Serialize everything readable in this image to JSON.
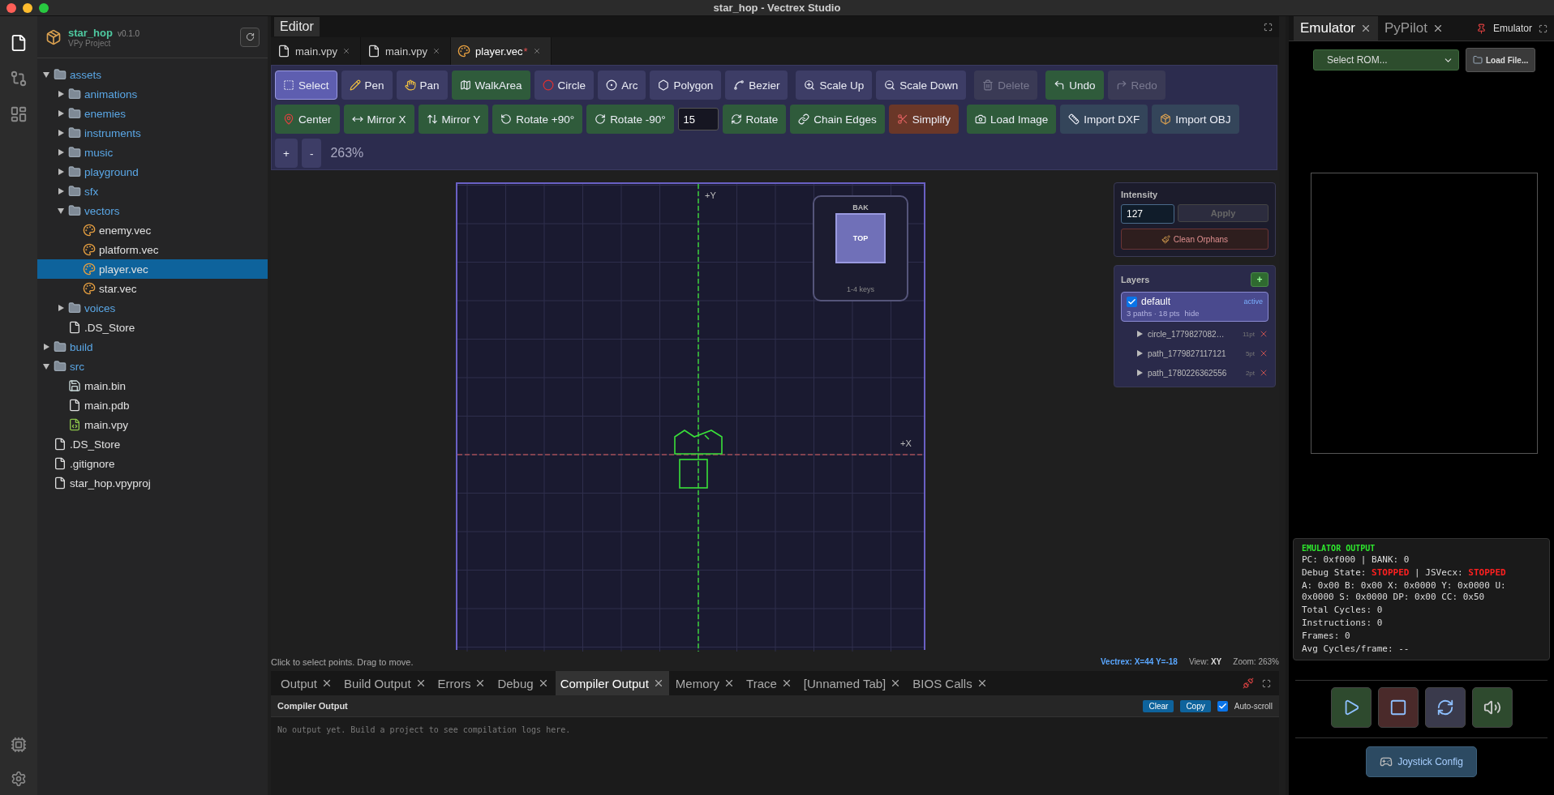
{
  "window": {
    "title": "star_hop - Vectrex Studio"
  },
  "activity_bar": {
    "items": [
      {
        "selected": true
      },
      {
        "selected": false
      },
      {
        "selected": false
      }
    ]
  },
  "project": {
    "name": "star_hop",
    "version": "v0.1.0",
    "subtitle": "VPy Project"
  },
  "file_tree": [
    {
      "label": "assets",
      "kind": "folder",
      "expanded": true,
      "selected": false,
      "children": [
        {
          "label": "animations",
          "kind": "folder",
          "expanded": false,
          "selected": false
        },
        {
          "label": "enemies",
          "kind": "folder",
          "expanded": false,
          "selected": false
        },
        {
          "label": "instruments",
          "kind": "folder",
          "expanded": false,
          "selected": false
        },
        {
          "label": "music",
          "kind": "folder",
          "expanded": false,
          "selected": false
        },
        {
          "label": "playground",
          "kind": "folder",
          "expanded": false,
          "selected": false
        },
        {
          "label": "sfx",
          "kind": "folder",
          "expanded": false,
          "selected": false
        },
        {
          "label": "vectors",
          "kind": "folder",
          "expanded": true,
          "selected": false,
          "children": [
            {
              "label": "enemy.vec",
              "kind": "vector",
              "selected": false
            },
            {
              "label": "platform.vec",
              "kind": "vector",
              "selected": false
            },
            {
              "label": "player.vec",
              "kind": "vector",
              "selected": true
            },
            {
              "label": "star.vec",
              "kind": "vector",
              "selected": false
            }
          ]
        },
        {
          "label": "voices",
          "kind": "folder",
          "expanded": false,
          "selected": false
        },
        {
          "label": ".DS_Store",
          "kind": "file",
          "selected": false
        }
      ]
    },
    {
      "label": "build",
      "kind": "folder",
      "expanded": false,
      "selected": false
    },
    {
      "label": "src",
      "kind": "folder",
      "expanded": true,
      "selected": false,
      "children": [
        {
          "label": "main.bin",
          "kind": "binary",
          "selected": false
        },
        {
          "label": "main.pdb",
          "kind": "file",
          "selected": false
        },
        {
          "label": "main.vpy",
          "kind": "python",
          "selected": false
        }
      ]
    },
    {
      "label": ".DS_Store",
      "kind": "file",
      "selected": false
    },
    {
      "label": ".gitignore",
      "kind": "file",
      "selected": false
    },
    {
      "label": "star_hop.vpyproj",
      "kind": "file",
      "selected": false
    }
  ],
  "editor": {
    "title": "Editor",
    "tabs": [
      {
        "label": "main.vpy",
        "kind": "file",
        "selected": false
      },
      {
        "label": "main.vpy",
        "kind": "file",
        "selected": false
      },
      {
        "label": "player.vec",
        "kind": "vector",
        "selected": true,
        "marker": "*"
      }
    ]
  },
  "toolbar": {
    "rows": [
      {
        "groups": [
          [
            {
              "kind": "button",
              "label": "Select",
              "color": "#5e5eb0",
              "selected": true,
              "disabled": false
            },
            {
              "kind": "button",
              "label": "Pen",
              "color": "#3d3d66",
              "selected": false,
              "disabled": false
            },
            {
              "kind": "button",
              "label": "Pan",
              "color": "#3d3d66",
              "selected": false,
              "disabled": false
            },
            {
              "kind": "button",
              "label": "WalkArea",
              "color": "#2f5b3b",
              "selected": false,
              "disabled": false
            },
            {
              "kind": "button",
              "label": "Circle",
              "color": "#3d3d66",
              "selected": false,
              "disabled": false
            },
            {
              "kind": "button",
              "label": "Arc",
              "color": "#3d3d66",
              "selected": false,
              "disabled": false
            },
            {
              "kind": "button",
              "label": "Polygon",
              "color": "#3d3d66",
              "selected": false,
              "disabled": false
            },
            {
              "kind": "button",
              "label": "Bezier",
              "color": "#3d3d66",
              "selected": false,
              "disabled": false
            }
          ],
          [
            {
              "kind": "button",
              "label": "Scale Up",
              "color": "#3d3d66",
              "selected": false,
              "disabled": false
            },
            {
              "kind": "button",
              "label": "Scale Down",
              "color": "#3d3d66",
              "selected": false,
              "disabled": false
            }
          ],
          [
            {
              "kind": "button",
              "label": "Delete",
              "color": "#3a3a55",
              "selected": false,
              "disabled": true
            }
          ],
          [
            {
              "kind": "button",
              "label": "Undo",
              "color": "#2f5b3b",
              "selected": false,
              "disabled": false
            },
            {
              "kind": "button",
              "label": "Redo",
              "color": "#3a3a55",
              "selected": false,
              "disabled": true
            }
          ]
        ]
      },
      {
        "groups": [
          [
            {
              "kind": "button",
              "label": "Center",
              "color": "#2f5b3b",
              "selected": false,
              "disabled": false
            },
            {
              "kind": "button",
              "label": "Mirror X",
              "color": "#2f5b3b",
              "selected": false,
              "disabled": false
            },
            {
              "kind": "button",
              "label": "Mirror Y",
              "color": "#2f5b3b",
              "selected": false,
              "disabled": false
            },
            {
              "kind": "button",
              "label": "Rotate +90°",
              "color": "#2f5b3b",
              "selected": false,
              "disabled": false
            },
            {
              "kind": "button",
              "label": "Rotate -90°",
              "color": "#2f5b3b",
              "selected": false,
              "disabled": false
            },
            {
              "kind": "field",
              "value": "15"
            },
            {
              "kind": "button",
              "label": "Rotate",
              "color": "#2f5b3b",
              "selected": false,
              "disabled": false
            },
            {
              "kind": "button",
              "label": "Chain Edges",
              "color": "#2f5b3b",
              "selected": false,
              "disabled": false
            },
            {
              "kind": "button",
              "label": "Simplify",
              "color": "#6a3728",
              "selected": false,
              "disabled": false
            }
          ],
          [
            {
              "kind": "button",
              "label": "Load Image",
              "color": "#2f5b3b",
              "selected": false,
              "disabled": false
            },
            {
              "kind": "button",
              "label": "Import DXF",
              "color": "#34455a",
              "selected": false,
              "disabled": false
            },
            {
              "kind": "button",
              "label": "Import OBJ",
              "color": "#34455a",
              "selected": false,
              "disabled": false
            }
          ]
        ]
      },
      {
        "groups": [
          [
            {
              "kind": "button",
              "label": "+",
              "color": "#3d3d66",
              "selected": false,
              "disabled": false
            },
            {
              "kind": "button",
              "label": "-",
              "color": "#3d3d66",
              "selected": false,
              "disabled": false
            },
            {
              "kind": "readout",
              "value": "263%"
            }
          ]
        ]
      }
    ]
  },
  "canvas": {
    "y_label": "+Y",
    "x_label": "+X",
    "view_cube": {
      "back": "BAK",
      "face": "TOP",
      "hint": "1-4 keys"
    }
  },
  "intensity": {
    "title": "Intensity",
    "value": "127",
    "apply": "Apply",
    "apply_disabled": true,
    "clean": "Clean Orphans"
  },
  "layers": {
    "title": "Layers",
    "add": "+",
    "items": [
      {
        "name": "default",
        "checked": true,
        "selected": true,
        "badge": "active",
        "meta": "3 paths · 18 pts",
        "toggle": "hide",
        "paths": [
          {
            "name": "circle_1779827082…",
            "points": "11pt"
          },
          {
            "name": "path_1779827117121",
            "points": "5pt"
          },
          {
            "name": "path_1780226362556",
            "points": "2pt"
          }
        ]
      }
    ]
  },
  "status": {
    "hint": "Click to select points. Drag to move.",
    "coords": "Vectrex: X=44 Y=-18",
    "view": "View: **XY**",
    "zoom": "Zoom: 263%"
  },
  "bottom_panel": {
    "tabs": [
      {
        "label": "Output",
        "selected": false
      },
      {
        "label": "Build Output",
        "selected": false
      },
      {
        "label": "Errors",
        "selected": false
      },
      {
        "label": "Debug",
        "selected": false
      },
      {
        "label": "Compiler Output",
        "selected": true
      },
      {
        "label": "Memory",
        "selected": false
      },
      {
        "label": "Trace",
        "selected": false
      },
      {
        "label": "[Unnamed Tab]",
        "selected": false
      },
      {
        "label": "BIOS Calls",
        "selected": false
      }
    ],
    "title": "Compiler Output",
    "buttons": [
      "Clear",
      "Copy"
    ],
    "auto_scroll": {
      "label": "Auto-scroll",
      "checked": true
    },
    "placeholder": "No output yet. Build a project to see compilation logs here."
  },
  "emulator": {
    "tabs": [
      {
        "label": "Emulator",
        "selected": true
      },
      {
        "label": "PyPilot",
        "selected": false
      }
    ],
    "pinned": "Emulator",
    "rom_select": "Select ROM...",
    "load": "Load File...",
    "output": {
      "title": "EMULATOR OUTPUT",
      "lines": [
        [
          {
            "text": "PC: 0xf000 | BANK: 0",
            "alert": false
          }
        ],
        [
          {
            "text": "Debug State: ",
            "alert": false
          },
          {
            "text": "STOPPED",
            "alert": true
          },
          {
            "text": " | JSVecx: ",
            "alert": false
          },
          {
            "text": "STOPPED",
            "alert": true
          }
        ],
        [
          {
            "text": "A: 0x00 B: 0x00 X: 0x0000 Y: 0x0000 U: 0x0000 S: 0x0000 DP: 0x00 CC: 0x50",
            "alert": false
          }
        ],
        [
          {
            "text": "Total Cycles: 0",
            "alert": false
          }
        ],
        [
          {
            "text": "Instructions: 0",
            "alert": false
          }
        ],
        [
          {
            "text": "Frames: 0",
            "alert": false
          }
        ],
        [
          {
            "text": "Avg Cycles/frame: --",
            "alert": false
          }
        ]
      ]
    },
    "controls": [
      {
        "kind": "play"
      },
      {
        "kind": "stop"
      },
      {
        "kind": "reset"
      },
      {
        "kind": "sound"
      }
    ],
    "joystick": "Joystick Config"
  }
}
